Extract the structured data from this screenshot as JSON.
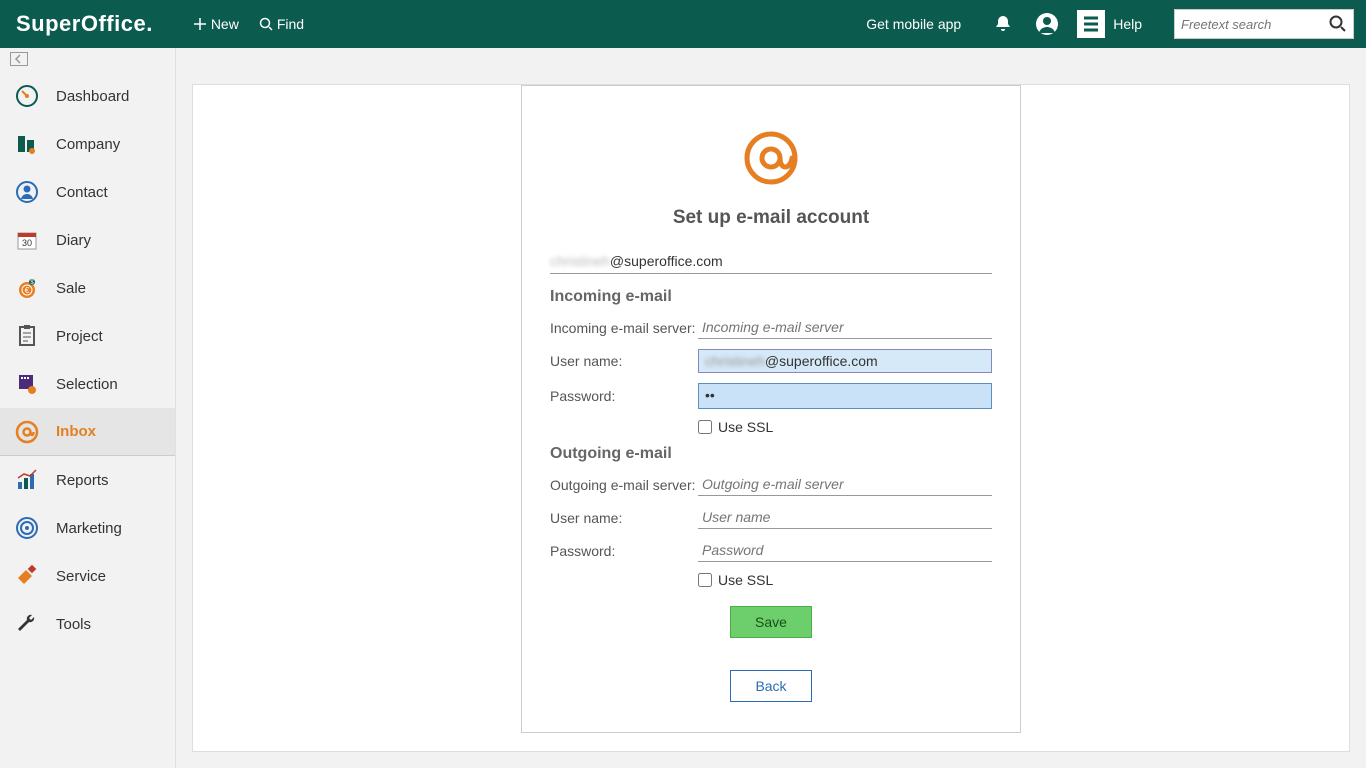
{
  "brand": "SuperOffice.",
  "header": {
    "new": "New",
    "find": "Find",
    "mobile": "Get mobile app",
    "help": "Help",
    "search_placeholder": "Freetext search"
  },
  "sidebar": {
    "items": [
      {
        "label": "Dashboard"
      },
      {
        "label": "Company"
      },
      {
        "label": "Contact"
      },
      {
        "label": "Diary"
      },
      {
        "label": "Sale"
      },
      {
        "label": "Project"
      },
      {
        "label": "Selection"
      },
      {
        "label": "Inbox"
      },
      {
        "label": "Reports"
      },
      {
        "label": "Marketing"
      },
      {
        "label": "Service"
      },
      {
        "label": "Tools"
      }
    ]
  },
  "dialog": {
    "title": "Set up e-mail account",
    "email_suffix": "@superoffice.com",
    "incoming": {
      "heading": "Incoming e-mail",
      "server_label": "Incoming e-mail server:",
      "server_placeholder": "Incoming e-mail server",
      "user_label": "User name:",
      "user_suffix": "@superoffice.com",
      "pass_label": "Password:",
      "pass_value": "••",
      "ssl_label": "Use SSL"
    },
    "outgoing": {
      "heading": "Outgoing e-mail",
      "server_label": "Outgoing e-mail server:",
      "server_placeholder": "Outgoing e-mail server",
      "user_label": "User name:",
      "user_placeholder": "User name",
      "pass_label": "Password:",
      "pass_placeholder": "Password",
      "ssl_label": "Use SSL"
    },
    "save": "Save",
    "back": "Back"
  }
}
